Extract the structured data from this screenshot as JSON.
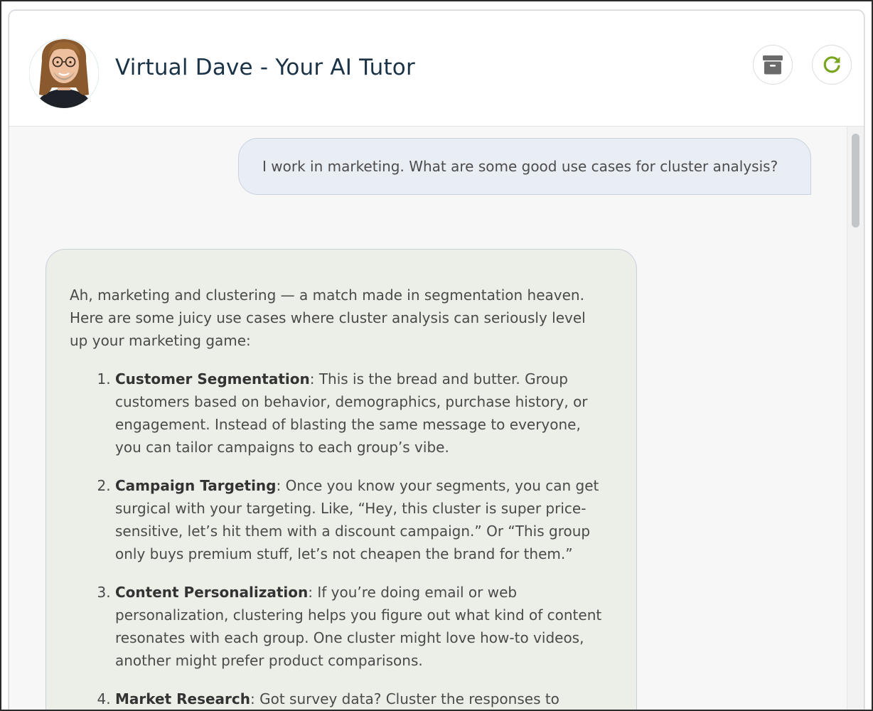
{
  "header": {
    "title": "Virtual Dave - Your AI Tutor",
    "avatar_alt": "Dave avatar",
    "archive_icon": "archive-icon",
    "refresh_icon": "refresh-icon",
    "refresh_color": "#7aa520",
    "archive_color": "#6b6b6b"
  },
  "messages": {
    "user": "I work in marketing. What are some good use cases for cluster analysis?",
    "bot_intro": "Ah, marketing and clustering — a match made in segmentation heaven. Here are some juicy use cases where cluster analysis can seriously level up your marketing game:",
    "bot_items": [
      {
        "title": "Customer Segmentation",
        "text": ": This is the bread and butter. Group customers based on behavior, demographics, purchase history, or engagement. Instead of blasting the same message to everyone, you can tailor campaigns to each group’s vibe."
      },
      {
        "title": "Campaign Targeting",
        "text": ": Once you know your segments, you can get surgical with your targeting. Like, “Hey, this cluster is super price-sensitive, let’s hit them with a discount campaign.” Or “This group only buys premium stuff, let’s not cheapen the brand for them.”"
      },
      {
        "title": "Content Personalization",
        "text": ": If you’re doing email or web personalization, clustering helps you figure out what kind of content resonates with each group. One cluster might love how-to videos, another might prefer product comparisons."
      },
      {
        "title": "Market Research",
        "text": ": Got survey data? Cluster the responses to"
      }
    ]
  },
  "colors": {
    "user_bubble": "#e9edf4",
    "bot_bubble": "#ecefe7",
    "title_text": "#1b3346"
  }
}
